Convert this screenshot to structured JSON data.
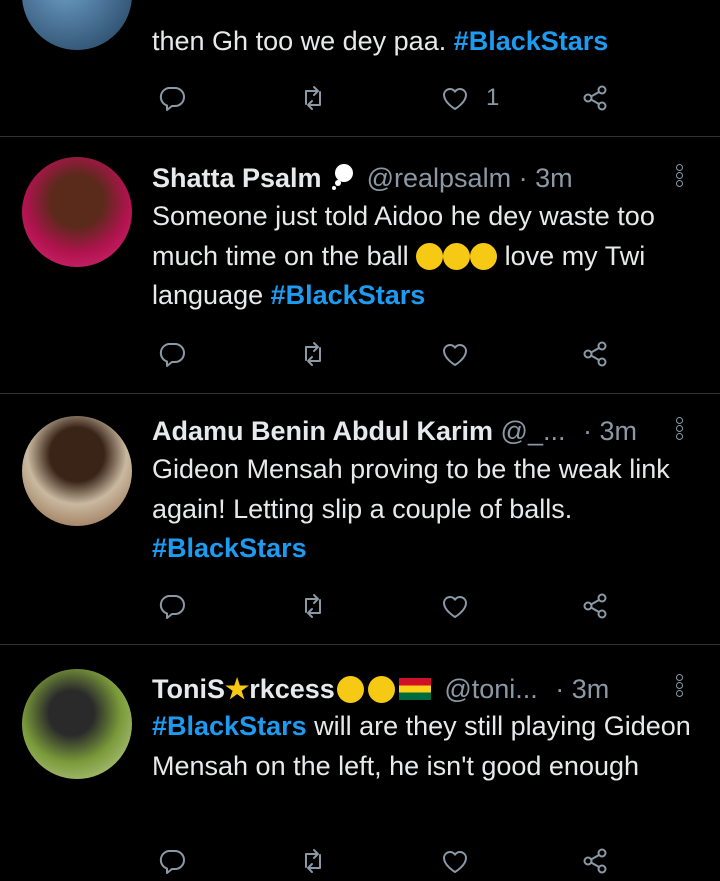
{
  "tweets": [
    {
      "text_line_prev": "...",
      "text_plain": "then Gh too we dey paa. ",
      "hashtag": "#BlackStars",
      "like_count": "1"
    },
    {
      "name": "Shatta Psalm",
      "handle": "@realpsalm",
      "time": "· 3m",
      "text_a": "Someone just told Aidoo he dey waste too much time on the ball",
      "text_b": " love my Twi language ",
      "hashtag": "#BlackStars"
    },
    {
      "name": "Adamu Benin Abdul Karim",
      "handle": "@_...",
      "time": "· 3m",
      "text": "Gideon Mensah proving to be the weak link again! Letting slip a couple of balls.",
      "hashtag": "#BlackStars"
    },
    {
      "name": "ToniS",
      "name_b": "rkcess",
      "handle": "@toni...",
      "time": "· 3m",
      "hashtag": "#BlackStars",
      "text": " will are they still playing Gideon Mensah on the left, he isn't good enough"
    }
  ],
  "colors": {
    "accent": "#1d9bf0",
    "muted": "#8b98a5",
    "divider": "#2f3336"
  },
  "icons": [
    "reply-icon",
    "retweet-icon",
    "like-icon",
    "share-icon",
    "more-icon"
  ]
}
